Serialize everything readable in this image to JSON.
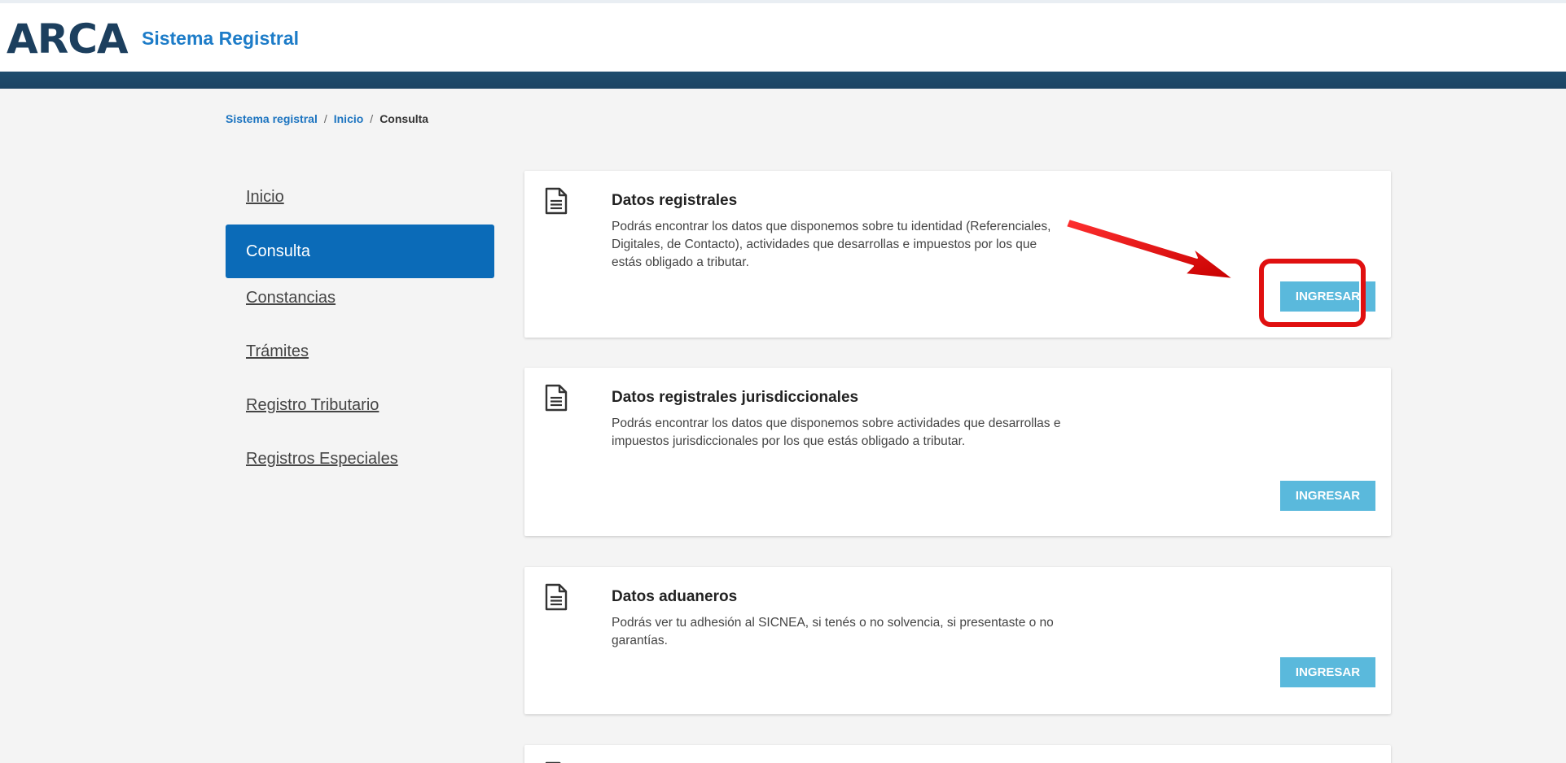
{
  "header": {
    "logo_text": "ARCA",
    "logo_subtitle": "Sistema Registral",
    "brand_color": "#1c3f5e",
    "accent_color": "#1d7cc8"
  },
  "breadcrumb": {
    "items": [
      "Sistema registral",
      "Inicio"
    ],
    "separator": "/",
    "current": "Consulta"
  },
  "sidenav": {
    "items": [
      {
        "label": "Inicio",
        "active": false
      },
      {
        "label": "Consulta",
        "active": true
      },
      {
        "label": "Constancias",
        "active": false
      },
      {
        "label": "Trámites",
        "active": false
      },
      {
        "label": "Registro Tributario",
        "active": false
      },
      {
        "label": "Registros Especiales",
        "active": false
      }
    ],
    "active_color": "#0b6bb8"
  },
  "cards": [
    {
      "icon": "document-icon",
      "title": "Datos registrales",
      "description": "Podrás encontrar los datos que disponemos sobre tu identidad (Referenciales, Digitales, de Contacto), actividades que desarrollas e impuestos por los que estás obligado a tributar.",
      "button_label": "INGRESAR",
      "highlighted": true
    },
    {
      "icon": "document-icon",
      "title": "Datos registrales jurisdiccionales",
      "description": "Podrás encontrar los datos que disponemos sobre actividades que desarrollas e impuestos jurisdiccionales por los que estás obligado a tributar.",
      "button_label": "INGRESAR",
      "highlighted": false
    },
    {
      "icon": "document-icon",
      "title": "Datos aduaneros",
      "description": "Podrás ver tu adhesión al SICNEA, si tenés o no solvencia, si presentaste o no garantías.",
      "button_label": "INGRESAR",
      "highlighted": false
    },
    {
      "icon": "document-icon",
      "title": "",
      "description": "",
      "button_label": "",
      "highlighted": false
    }
  ],
  "button_color": "#5ab9dc",
  "annotation_color": "#e01010"
}
